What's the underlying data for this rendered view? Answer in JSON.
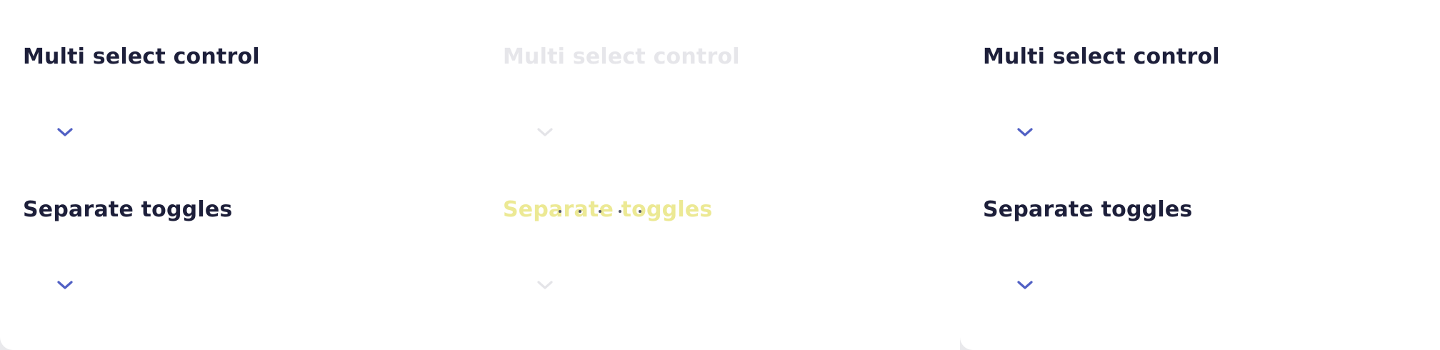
{
  "panels": [
    {
      "multi_select": {
        "title": "Multi select control",
        "chevron": "chevron-down-icon"
      },
      "separate_toggles": {
        "title": "Separate toggles",
        "chevron": "chevron-down-icon"
      }
    },
    {
      "multi_select": {
        "title": "Multi select control",
        "chevron": "chevron-down-icon"
      },
      "separate_toggles": {
        "title": "Separate toggles",
        "chevron": "chevron-down-icon"
      }
    },
    {
      "multi_select": {
        "title": "Multi select control",
        "chevron": "chevron-down-icon"
      },
      "separate_toggles": {
        "title": "Separate toggles",
        "chevron": "chevron-down-icon"
      }
    }
  ],
  "colors": {
    "title": "#1d1f3a",
    "chevron": "#5160c4",
    "background": "#ffffff",
    "faded_title": "#e6e6ea",
    "faded_highlight": "#ece994"
  }
}
